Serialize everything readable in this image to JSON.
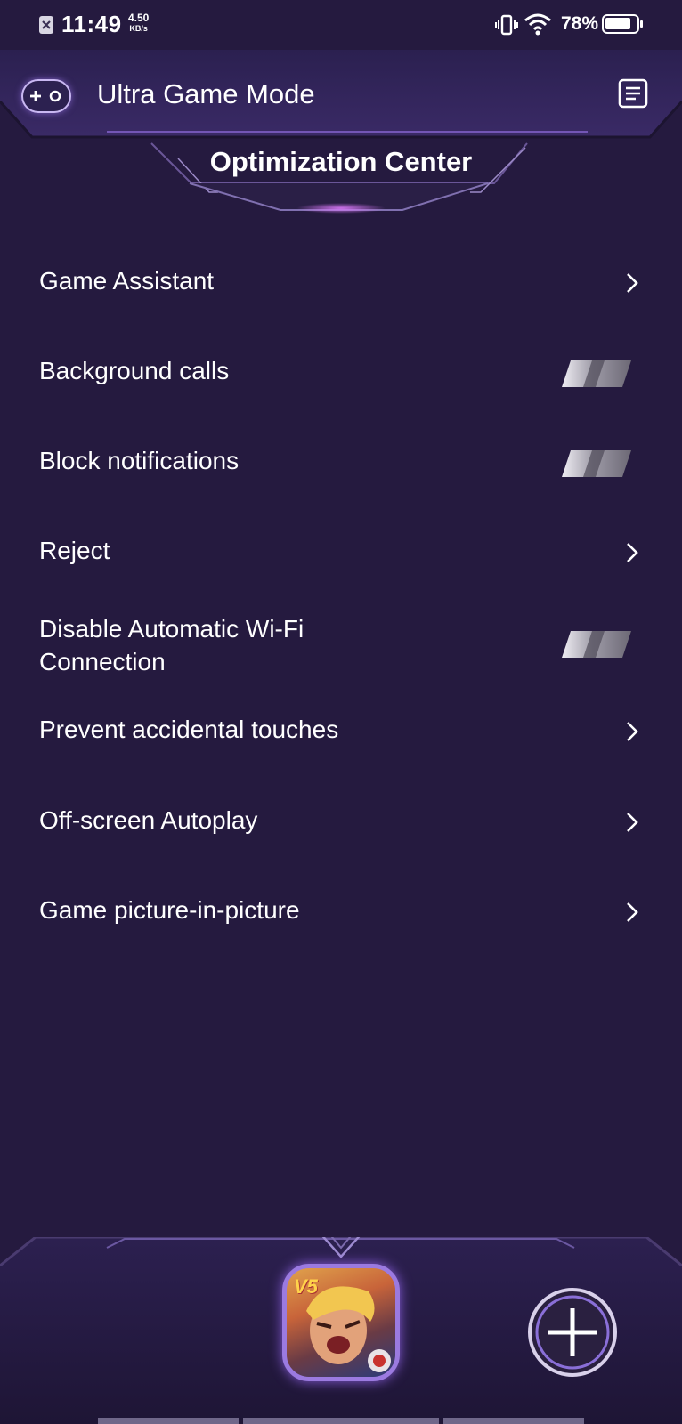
{
  "status_bar": {
    "time": "11:49",
    "speed_value": "4.50",
    "speed_unit": "KB/s",
    "battery_percent": "78%"
  },
  "header": {
    "title": "Ultra Game Mode",
    "section_title": "Optimization Center"
  },
  "menu_items": [
    {
      "label": "Game Assistant",
      "control": "chevron"
    },
    {
      "label": "Background calls",
      "control": "toggle",
      "state": "off"
    },
    {
      "label": "Block notifications",
      "control": "toggle",
      "state": "off"
    },
    {
      "label": "Reject",
      "control": "chevron"
    },
    {
      "label": "Disable Automatic Wi-Fi Connection",
      "control": "toggle",
      "state": "off"
    },
    {
      "label": "Prevent accidental touches",
      "control": "chevron"
    },
    {
      "label": "Off-screen Autoplay",
      "control": "chevron"
    },
    {
      "label": "Game picture-in-picture",
      "control": "chevron"
    }
  ],
  "dock": {
    "game_badge": "V5"
  },
  "colors": {
    "background": "#251a3f",
    "accent": "#a77bf0",
    "text": "#ffffff"
  }
}
